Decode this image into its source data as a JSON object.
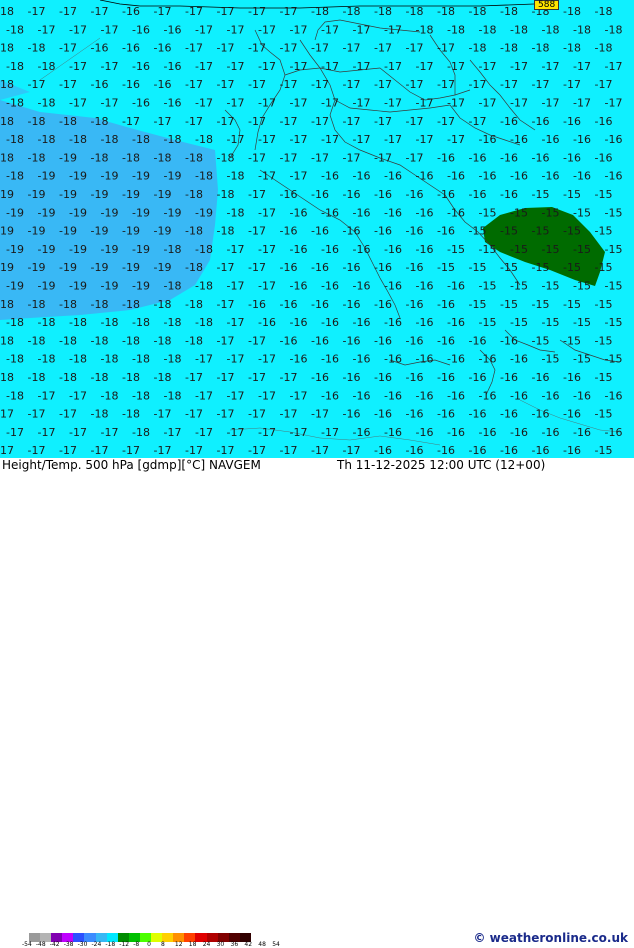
{
  "title": "Height/Temp. 500 hPa [gdmp][°C] NAVGEM",
  "valid_time": "Th 11-12-2025 12:00 UTC (12+00)",
  "site": "© weatheronline.co.uk",
  "contour_tag": "588",
  "colors": {
    "sea_field": "#0ff0ff",
    "cold_field": "#39b8f5",
    "warm_blob": "#006b00",
    "border_line": "#3a3a3a"
  },
  "legend": {
    "labels": [
      "-54",
      "-48",
      "-42",
      "-38",
      "-30",
      "-24",
      "-18",
      "-12",
      "-8",
      "0",
      "8",
      "12",
      "18",
      "24",
      "30",
      "36",
      "42",
      "48",
      "54"
    ],
    "colors": [
      "#9a9a9a",
      "#b4b4b4",
      "#8000b0",
      "#c000ff",
      "#2c50ff",
      "#3c8cff",
      "#38b8f5",
      "#00e8ff",
      "#008c00",
      "#00c000",
      "#4cff00",
      "#e0ff00",
      "#ffd000",
      "#ff9000",
      "#ff4000",
      "#e00000",
      "#b00000",
      "#800000",
      "#500000",
      "#300000"
    ]
  },
  "grid_rows": [
    "-18 -17 -17 -17 -16 -17 -17 -17 -17 -17 -18 -18 -18 -18 -18 -18 -18 -18 -18 -18",
    "-18 -17 -17 -17 -16 -16 -17 -17 -17 -17 -17 -17 -17 -18 -18 -18 -18 -18 -18 -18",
    "-18 -18 -17 -16 -16 -16 -17 -17 -17 -17 -17 -17 -17 -17 -17 -18 -18 -18 -18 -18",
    "-18 -18 -17 -17 -16 -16 -17 -17 -17 -17 -17 -17 -17 -17 -17 -17 -17 -17 -17 -17",
    "-18 -17 -17 -16 -16 -16 -17 -17 -17 -17 -17 -17 -17 -17 -17 -17 -17 -17 -17 -17",
    "-18 -18 -17 -17 -16 -16 -17 -17 -17 -17 -17 -17 -17 -17 -17 -17 -17 -17 -17 -17",
    "-18 -18 -18 -18 -17 -17 -17 -17 -17 -17 -17 -17 -17 -17 -17 -17 -16 -16 -16 -16",
    "-18 -18 -18 -18 -18 -18 -18 -17 -17 -17 -17 -17 -17 -17 -17 -16 -16 -16 -16 -16",
    "-18 -18 -19 -18 -18 -18 -18 -18 -17 -17 -17 -17 -17 -17 -16 -16 -16 -16 -16 -16",
    "-18 -19 -19 -19 -19 -19 -18 -18 -17 -17 -16 -16 -16 -16 -16 -16 -16 -16 -16 -16",
    "-19 -19 -19 -19 -19 -19 -18 -18 -17 -16 -16 -16 -16 -16 -16 -16 -16 -15 -15 -15",
    "-19 -19 -19 -19 -19 -19 -19 -18 -17 -16 -16 -16 -16 -16 -16 -15 -15 -15 -15 -15",
    "-19 -19 -19 -19 -19 -19 -18 -18 -17 -16 -16 -16 -16 -16 -16 -15 -15 -15 -15 -15",
    "-19 -19 -19 -19 -19 -18 -18 -17 -17 -16 -16 -16 -16 -16 -15 -15 -15 -15 -15 -15",
    "-19 -19 -19 -19 -19 -19 -18 -17 -17 -16 -16 -16 -16 -16 -15 -15 -15 -15 -15 -15",
    "-19 -19 -19 -19 -19 -18 -18 -17 -17 -16 -16 -16 -16 -16 -16 -15 -15 -15 -15 -15",
    "-18 -18 -18 -18 -18 -18 -18 -17 -16 -16 -16 -16 -16 -16 -16 -15 -15 -15 -15 -15",
    "-18 -18 -18 -18 -18 -18 -18 -17 -16 -16 -16 -16 -16 -16 -16 -15 -15 -15 -15 -15",
    "-18 -18 -18 -18 -18 -18 -18 -17 -17 -16 -16 -16 -16 -16 -16 -16 -16 -15 -15 -15",
    "-18 -18 -18 -18 -18 -18 -17 -17 -17 -16 -16 -16 -16 -16 -16 -16 -16 -15 -15 -15",
    "-18 -18 -18 -18 -18 -18 -17 -17 -17 -17 -16 -16 -16 -16 -16 -16 -16 -16 -16 -15",
    "-18 -17 -17 -18 -18 -18 -17 -17 -17 -17 -16 -16 -16 -16 -16 -16 -16 -16 -16 -16",
    "-17 -17 -17 -18 -18 -17 -17 -17 -17 -17 -17 -16 -16 -16 -16 -16 -16 -16 -16 -15",
    "-17 -17 -17 -17 -18 -17 -17 -17 -17 -17 -17 -16 -16 -16 -16 -16 -16 -16 -16 -16",
    "-17 -17 -17 -17 -17 -17 -17 -17 -17 -17 -17 -17 -16 -16 -16 -16 -16 -16 -16 -15",
    "-17 -17 -17 -17 -17 -17 -17 -17 -17 -17 -17 -17 -16 -16 -16 -16 -16 -16 -16 -16"
  ]
}
